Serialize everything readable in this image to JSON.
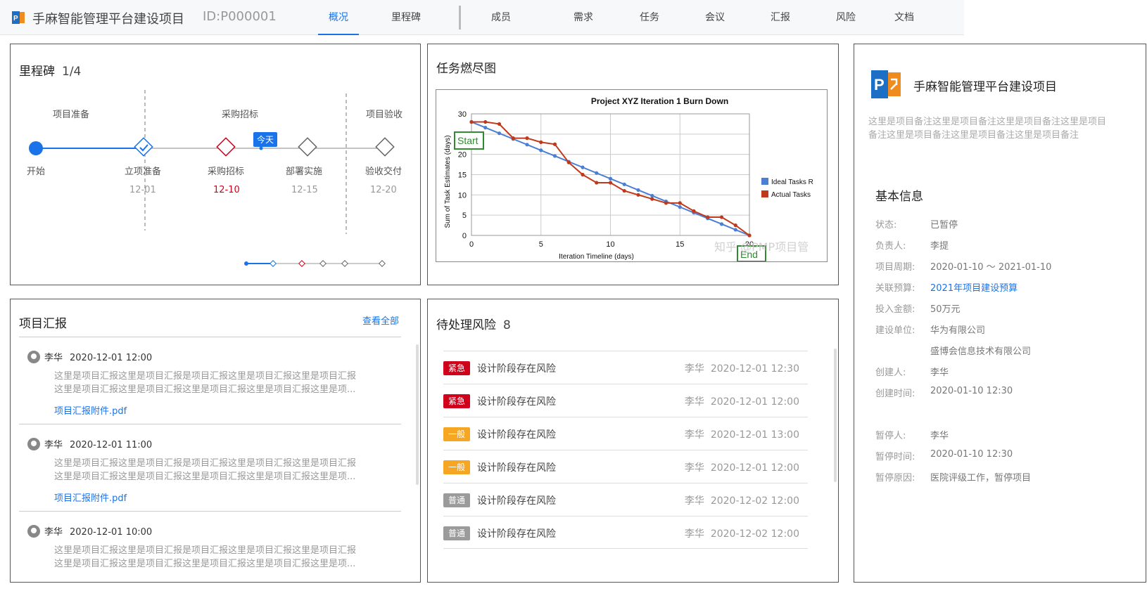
{
  "header": {
    "title": "手麻智能管理平台建设项目",
    "id_text": "ID:P000001",
    "tabs": [
      "概况",
      "里程碑",
      "成员",
      "需求",
      "任务",
      "会议",
      "汇报",
      "风险",
      "文档"
    ],
    "active_tab": "概况"
  },
  "milestone": {
    "title": "里程碑",
    "count": "1/4",
    "phases": [
      "项目准备",
      "采购招标",
      "项目验收"
    ],
    "nodes": [
      {
        "label": "开始",
        "date": ""
      },
      {
        "label": "立项准备",
        "date": "12-01"
      },
      {
        "label": "采购招标",
        "date": "12-10"
      },
      {
        "label": "部署实施",
        "date": "12-15"
      },
      {
        "label": "验收交付",
        "date": "12-20"
      }
    ],
    "today": "今天"
  },
  "burndown": {
    "title": "任务燃尽图",
    "start_label": "Start",
    "end_label": "End",
    "watermark": "知乎 @PMP项目管",
    "chart_data": {
      "type": "line",
      "title": "Project XYZ Iteration 1 Burn Down",
      "xlabel": "Iteration Timeline (days)",
      "ylabel": "Sum of Task Estimates (days)",
      "xlim": [
        0,
        20
      ],
      "ylim": [
        0,
        30
      ],
      "xticks": [
        0,
        5,
        10,
        15,
        20
      ],
      "yticks": [
        0,
        5,
        10,
        15,
        20,
        25,
        30
      ],
      "legend_position": "right",
      "series": [
        {
          "name": "Ideal Tasks R",
          "color": "#4a7fd4",
          "x": [
            0,
            1,
            2,
            3,
            4,
            5,
            6,
            7,
            8,
            9,
            10,
            11,
            12,
            13,
            14,
            15,
            16,
            17,
            18,
            19,
            20
          ],
          "y": [
            28,
            26.6,
            25.2,
            23.8,
            22.4,
            21,
            19.6,
            18.2,
            16.8,
            15.4,
            14,
            12.6,
            11.2,
            9.8,
            8.4,
            7,
            5.6,
            4.2,
            2.8,
            1.4,
            0
          ]
        },
        {
          "name": "Actual Tasks",
          "color": "#c0391b",
          "x": [
            0,
            1,
            2,
            3,
            4,
            5,
            6,
            7,
            8,
            9,
            10,
            11,
            12,
            13,
            14,
            15,
            16,
            17,
            18,
            19,
            20
          ],
          "y": [
            28,
            28,
            27.5,
            24,
            24,
            23,
            22.5,
            18,
            15,
            13,
            13,
            11,
            10,
            9,
            8,
            8,
            6,
            4.5,
            4.5,
            2.5,
            0
          ]
        }
      ]
    }
  },
  "reports": {
    "title": "项目汇报",
    "view_all": "查看全部",
    "items": [
      {
        "author": "李华",
        "time": "2020-12-01 12:00",
        "line1": "这里是项目汇报这里是项目汇报是项目汇报这里是项目汇报这里是项目汇报",
        "line2": "这里是项目汇报这里是项目汇报这里是项目汇报这里是项目汇报这里是项...",
        "attachment": "项目汇报附件.pdf"
      },
      {
        "author": "李华",
        "time": "2020-12-01 11:00",
        "line1": "这里是项目汇报这里是项目汇报是项目汇报这里是项目汇报这里是项目汇报",
        "line2": "这里是项目汇报这里是项目汇报这里是项目汇报这里是项目汇报这里是项...",
        "attachment": "项目汇报附件.pdf"
      },
      {
        "author": "李华",
        "time": "2020-12-01 10:00",
        "line1": "这里是项目汇报这里是项目汇报是项目汇报这里是项目汇报这里是项目汇报",
        "line2": "这里是项目汇报这里是项目汇报这里是项目汇报这里是项目汇报这里是项...",
        "attachment": ""
      }
    ]
  },
  "risks": {
    "title": "待处理风险",
    "count": "8",
    "items": [
      {
        "level": "紧急",
        "color": "#d0021b",
        "name": "设计阶段存在风险",
        "owner": "李华",
        "time": "2020-12-01 12:30"
      },
      {
        "level": "紧急",
        "color": "#d0021b",
        "name": "设计阶段存在风险",
        "owner": "李华",
        "time": "2020-12-01 12:00"
      },
      {
        "level": "一般",
        "color": "#f5a623",
        "name": "设计阶段存在风险",
        "owner": "李华",
        "time": "2020-12-01 13:00"
      },
      {
        "level": "一般",
        "color": "#f5a623",
        "name": "设计阶段存在风险",
        "owner": "李华",
        "time": "2020-12-01 12:00"
      },
      {
        "level": "普通",
        "color": "#9b9b9b",
        "name": "设计阶段存在风险",
        "owner": "李华",
        "time": "2020-12-02 12:00"
      },
      {
        "level": "普通",
        "color": "#9b9b9b",
        "name": "设计阶段存在风险",
        "owner": "李华",
        "time": "2020-12-02 12:00"
      }
    ]
  },
  "info": {
    "project_name": "手麻智能管理平台建设项目",
    "note_line1": "这里是项目备注这里是项目备注这里是项目备注这里是项目",
    "note_line2": "备注这里是项目备注这里是项目备注这里是项目备注",
    "section_title": "基本信息",
    "rows": [
      {
        "label": "状态:",
        "value": "已暂停"
      },
      {
        "label": "负责人:",
        "value": "李提"
      },
      {
        "label": "项目周期:",
        "value": "2020-01-10 ～ 2021-01-10"
      },
      {
        "label": "关联预算:",
        "value": "2021年项目建设预算",
        "link": true
      },
      {
        "label": "投入金额:",
        "value": "50万元"
      },
      {
        "label": "建设单位:",
        "value": "华为有限公司"
      },
      {
        "label": "",
        "value": "盛博会信息技术有限公司"
      },
      {
        "label": "创建人:",
        "value": "李华"
      },
      {
        "label": "创建时间:",
        "value": "2020-01-10 12:30"
      },
      {
        "label": "暂停人:",
        "value": "李华"
      },
      {
        "label": "暂停时间:",
        "value": "2020-01-10 12:30"
      },
      {
        "label": "暂停原因:",
        "value": "医院评级工作，暂停项目"
      }
    ]
  }
}
